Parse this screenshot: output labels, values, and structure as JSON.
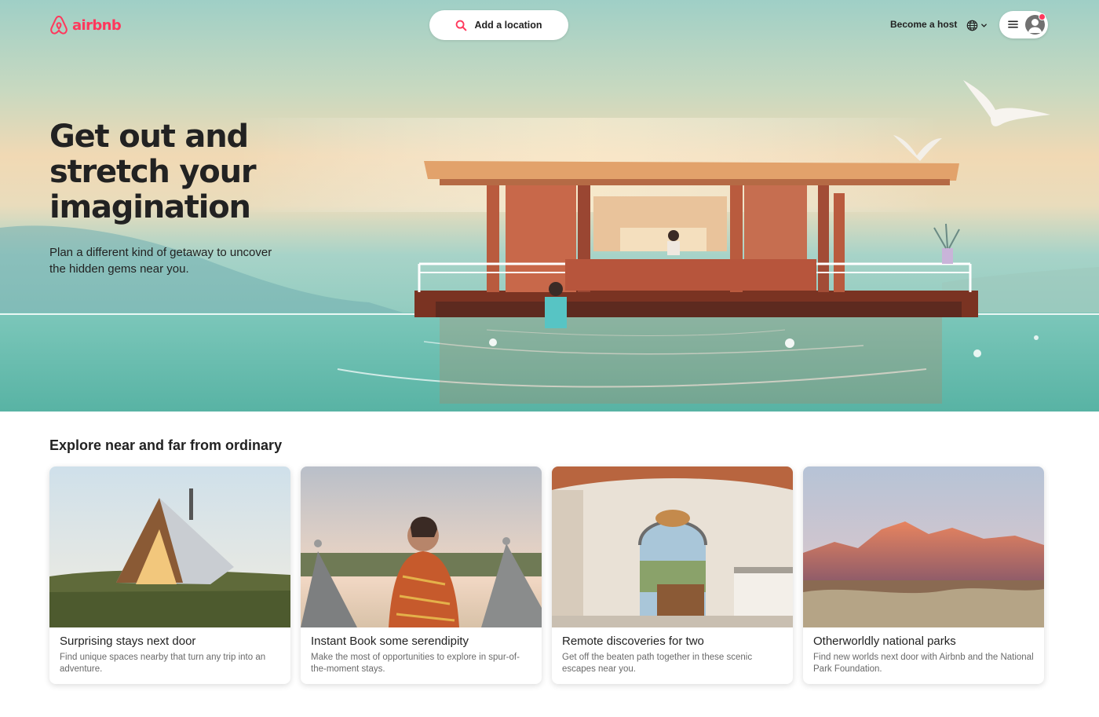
{
  "header": {
    "logo_text": "airbnb",
    "search_label": "Add a location",
    "host_link": "Become a host",
    "language_icon": "globe-icon",
    "menu_icon": "hamburger-icon"
  },
  "hero": {
    "title_lines": [
      "Get out and",
      "stretch your",
      "imagination"
    ],
    "subtitle": "Plan a different kind of getaway to uncover the hidden gems near you."
  },
  "explore": {
    "heading": "Explore near and far from ordinary",
    "cards": [
      {
        "title": "Surprising stays next door",
        "description": "Find unique spaces nearby that turn any trip into an adventure."
      },
      {
        "title": "Instant Book some serendipity",
        "description": "Make the most of opportunities to explore in spur-of-the-moment stays."
      },
      {
        "title": "Remote discoveries for two",
        "description": "Get off the beaten path together in these scenic escapes near you."
      },
      {
        "title": "Otherworldly national parks",
        "description": "Find new worlds next door with Airbnb and the National Park Foundation."
      }
    ]
  },
  "colors": {
    "brand": "#ff385c",
    "text_primary": "#222222",
    "text_secondary": "#6a6a6a"
  }
}
